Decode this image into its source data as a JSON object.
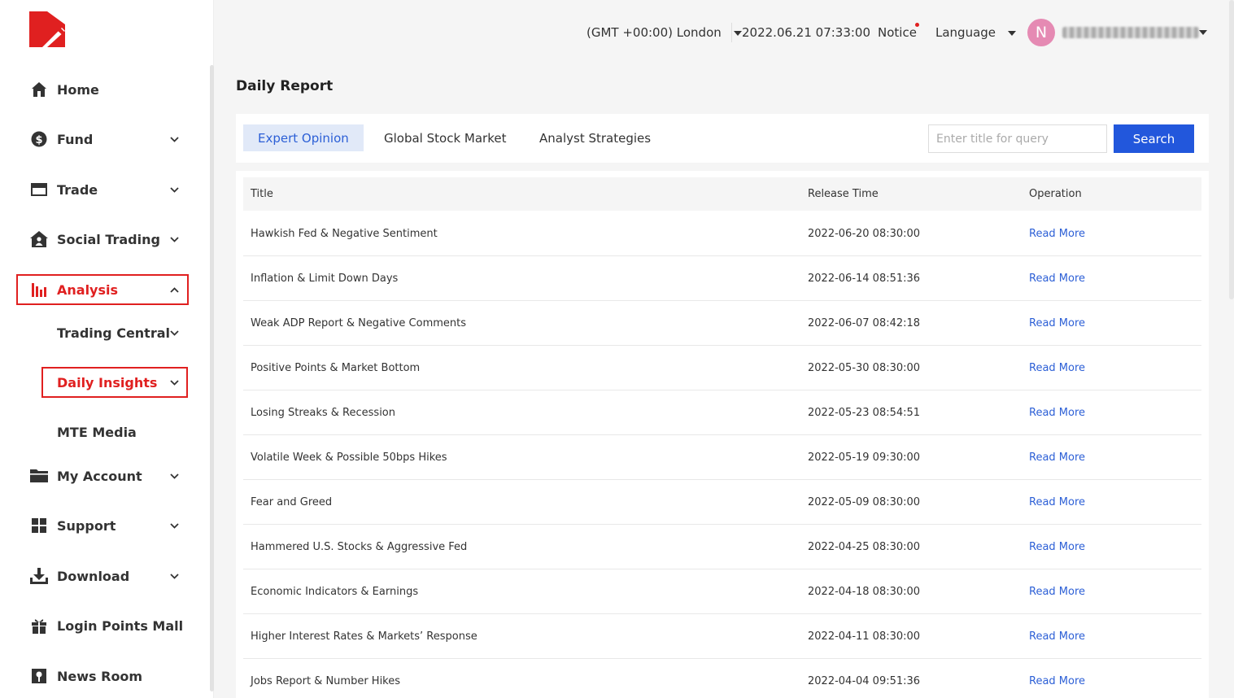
{
  "brand": {
    "accent": "#e02020",
    "link": "#2c5fd6",
    "button": "#2257dc"
  },
  "sidebar": {
    "items": [
      {
        "label": "Home",
        "icon": "home-icon"
      },
      {
        "label": "Fund",
        "icon": "dollar-circle-icon"
      },
      {
        "label": "Trade",
        "icon": "card-icon"
      },
      {
        "label": "Social Trading",
        "icon": "house-person-icon"
      },
      {
        "label": "Analysis",
        "icon": "bar-chart-icon"
      },
      {
        "label": "Trading Central"
      },
      {
        "label": "Daily Insights"
      },
      {
        "label": "MTE Media"
      },
      {
        "label": "My Account",
        "icon": "folder-icon"
      },
      {
        "label": "Support",
        "icon": "grid-icon"
      },
      {
        "label": "Download",
        "icon": "download-icon"
      },
      {
        "label": "Login Points Mall",
        "icon": "gift-icon"
      },
      {
        "label": "News Room",
        "icon": "news-icon"
      }
    ]
  },
  "topbar": {
    "timezone": "(GMT +00:00) London",
    "datetime": "2022.06.21 07:33:00",
    "notice": "Notice",
    "language": "Language",
    "avatar_initial": "N"
  },
  "page": {
    "title": "Daily Report"
  },
  "tabs": [
    "Expert Opinion",
    "Global Stock Market",
    "Analyst Strategies"
  ],
  "search": {
    "placeholder": "Enter title for query",
    "button": "Search"
  },
  "table": {
    "headers": [
      "Title",
      "Release Time",
      "Operation"
    ],
    "rows": [
      {
        "title": "Hawkish Fed & Negative Sentiment",
        "time": "2022-06-20 08:30:00",
        "op": "Read More"
      },
      {
        "title": "Inflation & Limit Down Days",
        "time": "2022-06-14 08:51:36",
        "op": "Read More"
      },
      {
        "title": "Weak ADP Report & Negative Comments",
        "time": "2022-06-07 08:42:18",
        "op": "Read More"
      },
      {
        "title": "Positive Points & Market Bottom",
        "time": "2022-05-30 08:30:00",
        "op": "Read More"
      },
      {
        "title": "Losing Streaks & Recession",
        "time": "2022-05-23 08:54:51",
        "op": "Read More"
      },
      {
        "title": "Volatile Week & Possible 50bps Hikes",
        "time": "2022-05-19 09:30:00",
        "op": "Read More"
      },
      {
        "title": "Fear and Greed",
        "time": "2022-05-09 08:30:00",
        "op": "Read More"
      },
      {
        "title": "Hammered U.S. Stocks & Aggressive Fed",
        "time": "2022-04-25 08:30:00",
        "op": "Read More"
      },
      {
        "title": "Economic Indicators & Earnings",
        "time": "2022-04-18 08:30:00",
        "op": "Read More"
      },
      {
        "title": "Higher Interest Rates & Markets’ Response",
        "time": "2022-04-11 08:30:00",
        "op": "Read More"
      },
      {
        "title": "Jobs Report & Number Hikes",
        "time": "2022-04-04 09:51:36",
        "op": "Read More"
      }
    ]
  }
}
